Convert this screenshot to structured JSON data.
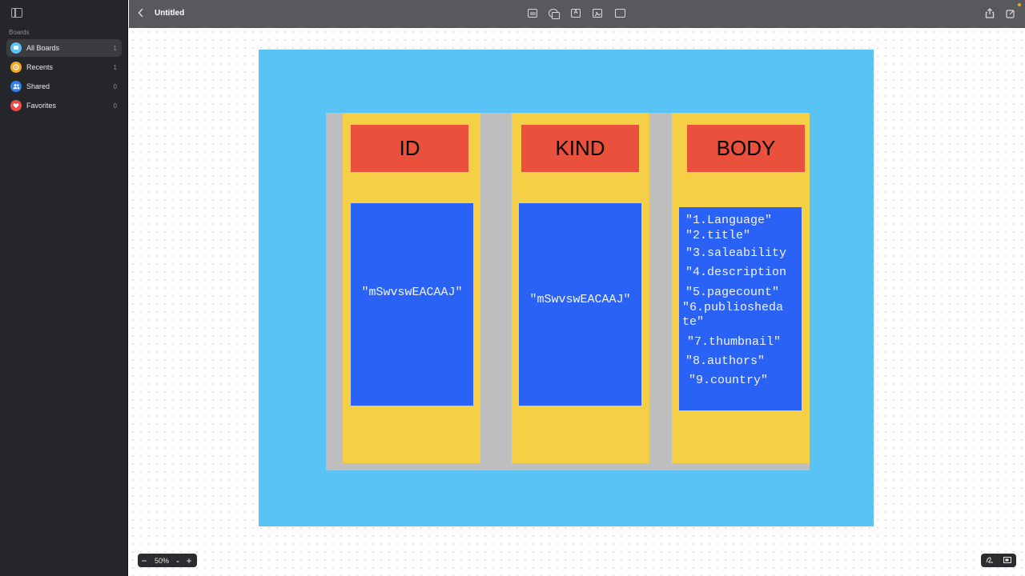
{
  "window": {
    "title": "Untitled"
  },
  "sidebar": {
    "section_label": "Boards",
    "items": [
      {
        "label": "All Boards",
        "count": "1",
        "icon": "all-boards-icon",
        "color": "#5ac3f5",
        "active": true
      },
      {
        "label": "Recents",
        "count": "1",
        "icon": "clock-icon",
        "color": "#f5a623",
        "active": false
      },
      {
        "label": "Shared",
        "count": "0",
        "icon": "people-icon",
        "color": "#2f7ff0",
        "active": false
      },
      {
        "label": "Favorites",
        "count": "0",
        "icon": "heart-icon",
        "color": "#ec4b47",
        "active": false
      }
    ]
  },
  "toolbar": {
    "tools": [
      "text-box-icon",
      "shapes-icon",
      "text-icon",
      "media-icon",
      "folder-icon"
    ],
    "text_tool_glyph": "A"
  },
  "board": {
    "columns": [
      {
        "header": "ID",
        "value": "\"mSwvswEACAAJ\""
      },
      {
        "header": "KIND",
        "value": "\"mSwvswEACAAJ\""
      },
      {
        "header": "BODY",
        "lines": [
          "\"1.Language\"",
          "\"2.title\"",
          "\"3.saleability",
          "\"4.description",
          "\"5.pagecount\"",
          "\"6.publiosheda",
          "te\"",
          "\"7.thumbnail\"",
          "\"8.authors\"",
          "\"9.country\""
        ]
      }
    ],
    "colors": {
      "background": "#5ac3f5",
      "panel": "#bebebe",
      "column": "#f5cf45",
      "header": "#ea513c",
      "value": "#2a62f5"
    }
  },
  "zoom": {
    "value": "50%",
    "minus": "−",
    "plus": "+"
  }
}
